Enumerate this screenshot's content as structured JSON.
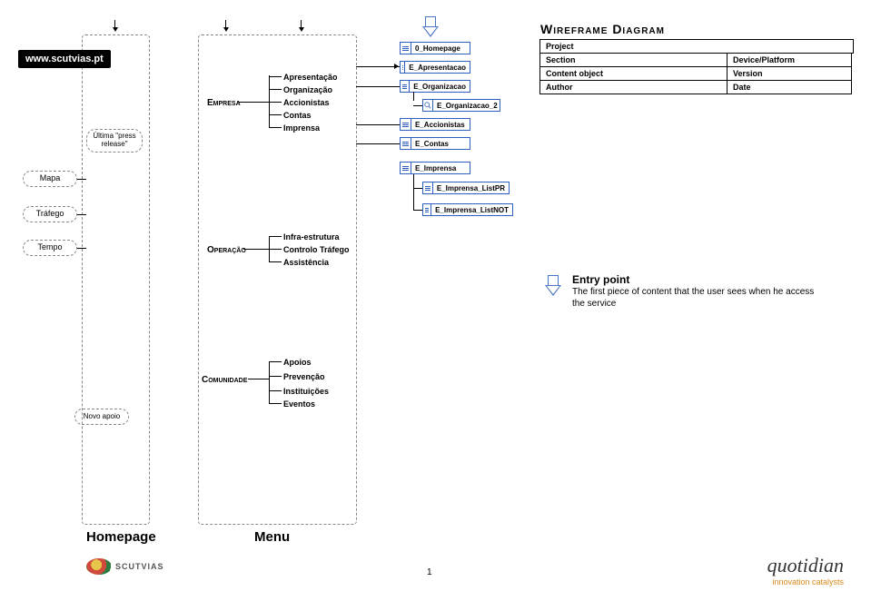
{
  "site_url": "www.scutvias.pt",
  "left_items": {
    "press": "Última \"press release\"",
    "mapa": "Mapa",
    "trafego": "Tráfego",
    "tempo": "Tempo",
    "novo": "Novo apoio"
  },
  "empresa": {
    "title": "Empresa",
    "children": [
      "Apresentação",
      "Organização",
      "Accionistas",
      "Contas",
      "Imprensa"
    ]
  },
  "operacao": {
    "title": "Operação",
    "children": [
      "Infra-estrutura",
      "Controlo Tráfego",
      "Assistência"
    ]
  },
  "comunidade": {
    "title": "Comunidade",
    "children": [
      "Apoios",
      "Prevenção",
      "Instituições",
      "Eventos"
    ]
  },
  "pages": {
    "home": "0_Homepage",
    "apres": "E_Apresentacao",
    "org": "E_Organizacao",
    "org2": "E_Organizacao_2",
    "acc": "E_Accionistas",
    "contas": "E_Contas",
    "imp": "E_Imprensa",
    "imp_pr": "E_Imprensa_ListPR",
    "imp_not": "E_Imprensa_ListNOT"
  },
  "panel": {
    "title": "Wireframe Diagram",
    "rows": [
      [
        "Project"
      ],
      [
        "Section",
        "Device/Platform"
      ],
      [
        "Content object",
        "Version"
      ],
      [
        "Author",
        "Date"
      ]
    ]
  },
  "entry": {
    "title": "Entry point",
    "body": "The first piece of content that the user sees when he access the service"
  },
  "footer": {
    "homepage": "Homepage",
    "menu": "Menu",
    "page": "1",
    "scutvias": "SCUTVIAS",
    "quotidian": "quotidian",
    "quotidian_tag": "innovation catalysts"
  }
}
